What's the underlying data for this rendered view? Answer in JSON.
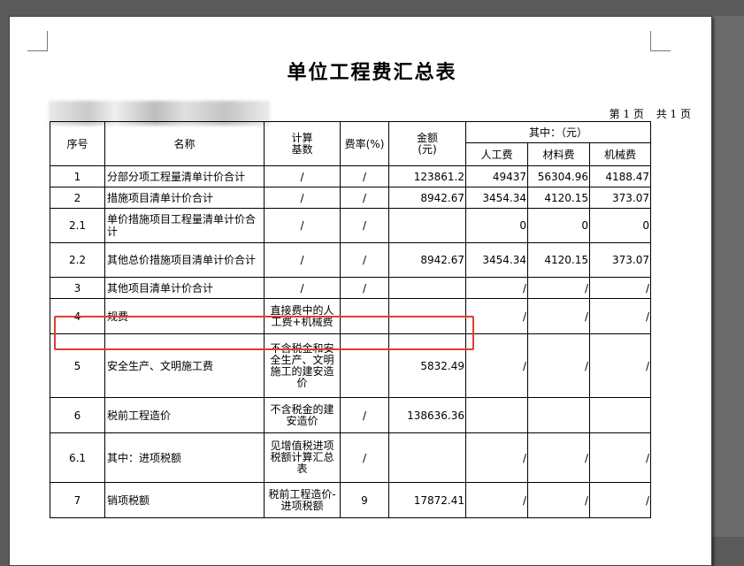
{
  "title": "单位工程费汇总表",
  "page_info": {
    "page": "第 1 页",
    "total": "共 1 页"
  },
  "headers": {
    "no": "序号",
    "name": "名称",
    "basis": "计算\n基数",
    "rate": "费率(%)",
    "amount": "金额\n(元)",
    "among": "其中：（元）",
    "labor": "人工费",
    "material": "材料费",
    "machine": "机械费"
  },
  "rows": [
    {
      "no": "1",
      "name": "分部分项工程量清单计价合计",
      "basis": "/",
      "rate": "/",
      "amount": "123861.2",
      "labor": "49437",
      "material": "56304.96",
      "machine": "4188.47"
    },
    {
      "no": "2",
      "name": "措施项目清单计价合计",
      "basis": "/",
      "rate": "/",
      "amount": "8942.67",
      "labor": "3454.34",
      "material": "4120.15",
      "machine": "373.07"
    },
    {
      "no": "2.1",
      "name": "单价措施项目工程量清单计价合计",
      "basis": "/",
      "rate": "/",
      "amount": "",
      "labor": "0",
      "material": "0",
      "machine": "0"
    },
    {
      "no": "2.2",
      "name": "其他总价措施项目清单计价合计",
      "basis": "/",
      "rate": "/",
      "amount": "8942.67",
      "labor": "3454.34",
      "material": "4120.15",
      "machine": "373.07"
    },
    {
      "no": "3",
      "name": "其他项目清单计价合计",
      "basis": "/",
      "rate": "/",
      "amount": "",
      "labor": "/",
      "material": "/",
      "machine": "/"
    },
    {
      "no": "4",
      "name": "规费",
      "basis": "直接费中的人工费+机械费",
      "rate": "",
      "amount": "",
      "labor": "/",
      "material": "/",
      "machine": "/"
    },
    {
      "no": "5",
      "name": "安全生产、文明施工费",
      "basis": "不含税金和安全生产、文明施工的建安造价",
      "rate": "",
      "amount": "5832.49",
      "labor": "/",
      "material": "/",
      "machine": "/"
    },
    {
      "no": "6",
      "name": "税前工程造价",
      "basis": "不含税金的建安造价",
      "rate": "/",
      "amount": "138636.36",
      "labor": "",
      "material": "",
      "machine": ""
    },
    {
      "no": "6.1",
      "name": "其中：进项税额",
      "basis": "见增值税进项税额计算汇总表",
      "rate": "/",
      "amount": "",
      "labor": "/",
      "material": "/",
      "machine": "/"
    },
    {
      "no": "7",
      "name": "销项税额",
      "basis": "税前工程造价-进项税额",
      "rate": "9",
      "amount": "17872.41",
      "labor": "/",
      "material": "/",
      "machine": "/"
    }
  ],
  "colors": {
    "highlight": "#e53935",
    "background": "#5a5a5a"
  }
}
